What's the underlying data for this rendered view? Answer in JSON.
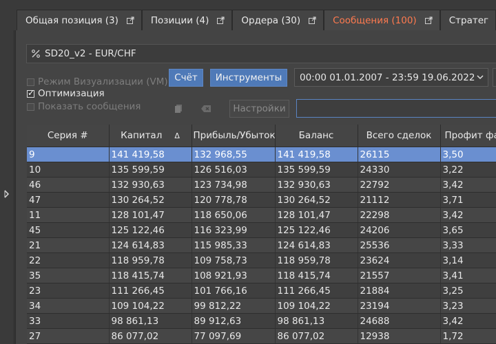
{
  "tabs": [
    {
      "label": "Общая позиция (3)",
      "active": false
    },
    {
      "label": "Позиции (4)",
      "active": false
    },
    {
      "label": "Ордера (30)",
      "active": false
    },
    {
      "label": "Сообщения (100)",
      "active": true
    },
    {
      "label": "Стратег",
      "active": false
    }
  ],
  "strategy": {
    "name": "SD20_v2  -  EUR/CHF"
  },
  "options": {
    "visual_mode": "Режим Визуализации (VM)",
    "optimization": "Оптимизация",
    "show_messages": "Показать сообщения"
  },
  "buttons": {
    "account": "Счёт",
    "tools": "Инструменты",
    "settings": "Настройки"
  },
  "date_range": "00:00 01.01.2007 - 23:59 19.06.2022",
  "colors": {
    "accent": "#ff7a4f",
    "selection": "#6a8fd0",
    "button": "#4f7ab8"
  },
  "table": {
    "headers": [
      "Серия #",
      "Капитал",
      "Прибыль/Убыток",
      "Баланс",
      "Всего сделок",
      "Профит фа"
    ],
    "sort_indicator": "Δ",
    "rows": [
      [
        "9",
        "141 419,58",
        "132 968,55",
        "141 419,58",
        "26115",
        "3,50"
      ],
      [
        "10",
        "135 599,59",
        "126 516,03",
        "135 599,59",
        "24330",
        "3,22"
      ],
      [
        "46",
        "132 930,63",
        "123 734,98",
        "132 930,63",
        "22792",
        "3,42"
      ],
      [
        "47",
        "130 264,52",
        "120 778,78",
        "130 264,52",
        "21112",
        "3,71"
      ],
      [
        "11",
        "128 101,47",
        "118 650,06",
        "128 101,47",
        "22298",
        "3,42"
      ],
      [
        "45",
        "125 122,46",
        "116 323,99",
        "125 122,46",
        "24206",
        "3,65"
      ],
      [
        "21",
        "124 614,83",
        "115 985,33",
        "124 614,83",
        "25536",
        "3,33"
      ],
      [
        "22",
        "118 959,78",
        "109 758,73",
        "118 959,78",
        "23624",
        "3,14"
      ],
      [
        "35",
        "118 415,74",
        "108 921,93",
        "118 415,74",
        "21557",
        "3,41"
      ],
      [
        "23",
        "111 266,45",
        "101 766,16",
        "111 266,45",
        "21884",
        "3,25"
      ],
      [
        "34",
        "109 104,22",
        "99 812,22",
        "109 104,22",
        "23194",
        "3,23"
      ],
      [
        "33",
        "98 861,13",
        "89 912,63",
        "98 861,13",
        "24688",
        "3,42"
      ],
      [
        "27",
        "86 077,02",
        "77 097,69",
        "86 077,02",
        "12938",
        "1,72"
      ]
    ]
  }
}
